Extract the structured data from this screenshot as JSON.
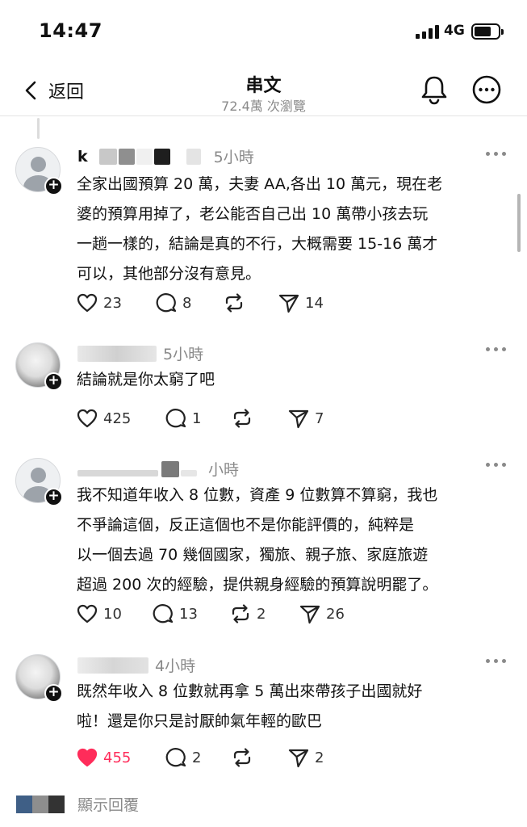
{
  "status_bar": {
    "time": "14:47",
    "network": "4G"
  },
  "nav": {
    "back_label": "返回",
    "title": "串文",
    "views": "72.4萬 次瀏覽"
  },
  "posts": [
    {
      "username": "k",
      "time": "5小時",
      "lines": [
        "全家出國預算 20 萬，夫妻 AA,各出 10 萬元，現在老",
        "婆的預算用掉了，老公能否自己出 10 萬帶小孩去玩",
        "一趟一樣的，結論是真的不行，大概需要 15-16 萬才",
        "可以，其他部分沒有意見。"
      ],
      "likes": "23",
      "replies": "8",
      "reposts": "",
      "shares": "14",
      "liked": false
    },
    {
      "username": "",
      "time": "5小時",
      "lines": [
        "結論就是你太窮了吧"
      ],
      "likes": "425",
      "replies": "1",
      "reposts": "",
      "shares": "7",
      "liked": false
    },
    {
      "username": "",
      "time": "小時",
      "lines": [
        "我不知道年收入 8 位數，資產 9 位數算不算窮，我也",
        "不爭論這個，反正這個也不是你能評價的，純粹是",
        "以一個去過 70 幾個國家，獨旅、親子旅、家庭旅遊",
        "超過 200 次的經驗，提供親身經驗的預算說明罷了。"
      ],
      "likes": "10",
      "replies": "13",
      "reposts": "2",
      "shares": "26",
      "liked": false
    },
    {
      "username": "",
      "time": "4小時",
      "lines": [
        "既然年收入 8 位數就再拿 5 萬出來帶孩子出國就好",
        "啦！還是你只是討厭帥氣年輕的歐巴"
      ],
      "likes": "455",
      "replies": "2",
      "reposts": "",
      "shares": "2",
      "liked": true
    }
  ],
  "show_replies_label": "顯示回覆",
  "icons": {
    "back": "chevron-left-icon",
    "bell": "bell-icon",
    "more": "more-circle-icon",
    "like": "heart-icon",
    "reply": "comment-icon",
    "repost": "repost-icon",
    "share": "send-icon"
  },
  "colors": {
    "liked": "#ff2c5a",
    "muted": "#8a8a8a",
    "text": "#111111"
  }
}
